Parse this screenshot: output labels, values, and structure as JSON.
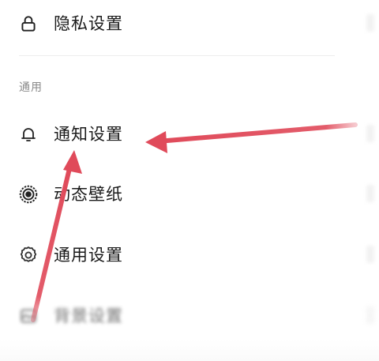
{
  "settings": {
    "items": [
      {
        "label": "隐私设置",
        "icon": "lock-icon"
      },
      {
        "label": "通知设置",
        "icon": "bell-icon"
      },
      {
        "label": "动态壁纸",
        "icon": "live-wallpaper-icon"
      },
      {
        "label": "通用设置",
        "icon": "gear-icon"
      },
      {
        "label": "背景设置",
        "icon": "background-icon"
      }
    ],
    "section_general": "通用"
  },
  "colors": {
    "arrow": "#e04a5a",
    "section_text": "#8a8a8a"
  }
}
